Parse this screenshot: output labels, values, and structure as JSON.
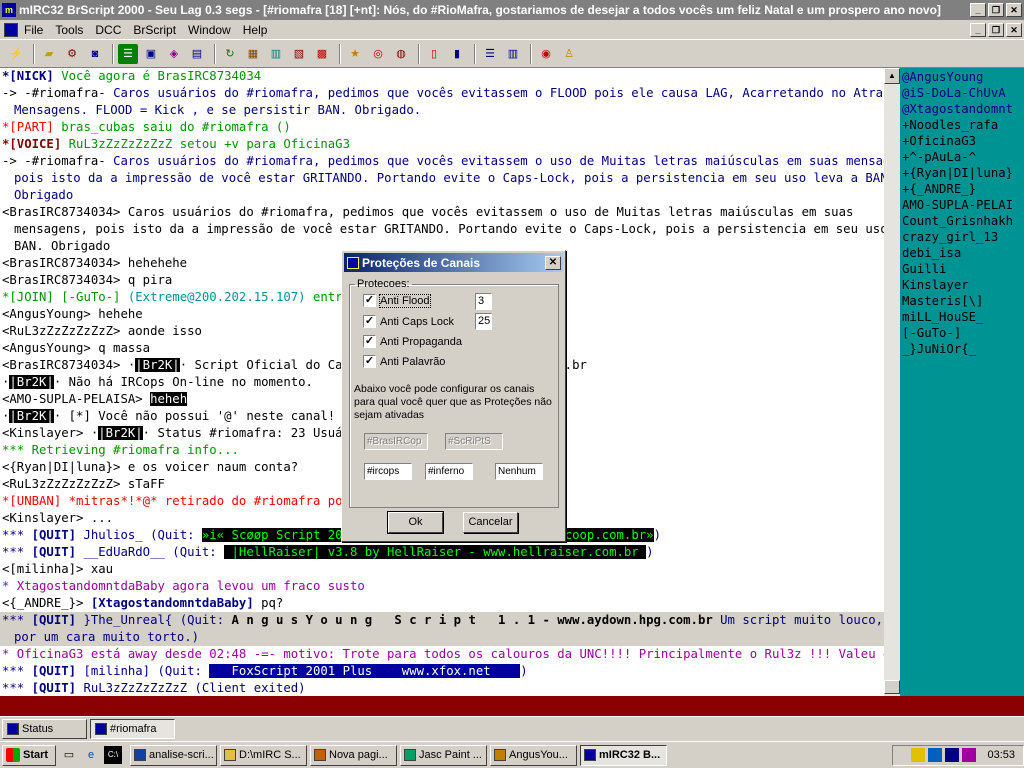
{
  "title": {
    "text": "mIRC32 BrScript 2000 - Seu Lag 0.3 segs - [#riomafra [18] [+nt]: Nós, do #RioMafra, gostariamos de desejar a todos vocês um feliz Natal e um prospero ano novo]",
    "buttons": [
      "_",
      "❐",
      "✕"
    ]
  },
  "menu": {
    "items": [
      "File",
      "Tools",
      "DCC",
      "BrScript",
      "Window",
      "Help"
    ],
    "right_buttons": [
      "_",
      "❐",
      "✕"
    ]
  },
  "toolbar": {
    "icons": [
      "connect-icon",
      "folder-icon",
      "settings-icon",
      "address-book-icon",
      "list-icon",
      "notify-icon",
      "dcc-send-icon",
      "dcc-chat-icon",
      "send-icon",
      "options-icon",
      "script-editor-icon",
      "remote-icon",
      "colors-icon",
      "users-icon",
      "log-icon",
      "tile-icon",
      "cascade-icon",
      "help-icon",
      "about-icon"
    ]
  },
  "chat": {
    "lines": [
      {
        "cls": "",
        "parts": [
          {
            "t": "*[NICK] ",
            "c": "blu bold"
          },
          {
            "t": "Você agora é BrasIRC8734034",
            "c": "grn"
          }
        ]
      },
      {
        "cls": "",
        "parts": [
          {
            "t": "-> -#riomafra- ",
            "c": "nick"
          },
          {
            "t": "Caros usuários do #riomafra, pedimos que vocês evitassem o FLOOD pois ele causa LAG, Acarretando no Atraso de",
            "c": "blu"
          }
        ]
      },
      {
        "cls": "ind",
        "parts": [
          {
            "t": "Mensagens. FLOOD = Kick , e se persistir BAN. Obrigado.",
            "c": "blu"
          }
        ]
      },
      {
        "cls": "",
        "parts": [
          {
            "t": "*[PART] ",
            "c": "red"
          },
          {
            "t": "bras_cubas saiu do #riomafra ()",
            "c": "grn"
          }
        ]
      },
      {
        "cls": "",
        "parts": [
          {
            "t": "*[VOICE] ",
            "c": "brw bold"
          },
          {
            "t": "RuL3zZzZzZzZzZ setou +v para OficinaG3",
            "c": "grn"
          }
        ]
      },
      {
        "cls": "",
        "parts": [
          {
            "t": "-> -#riomafra- ",
            "c": "nick"
          },
          {
            "t": "Caros usuários do #riomafra, pedimos que vocês evitassem o uso de Muitas letras maiúsculas em suas mensagens,",
            "c": "blu"
          }
        ]
      },
      {
        "cls": "ind",
        "parts": [
          {
            "t": "pois isto da a impressão de você estar GRITANDO. Portando evite o Caps-Lock, pois a persistencia em seu uso leva a BAN.",
            "c": "blu"
          }
        ]
      },
      {
        "cls": "ind",
        "parts": [
          {
            "t": "Obrigado",
            "c": "blu"
          }
        ]
      },
      {
        "cls": "",
        "parts": [
          {
            "t": "<BrasIRC8734034> ",
            "c": "nick"
          },
          {
            "t": "Caros usuários do #riomafra, pedimos que vocês evitassem o uso de Muitas letras maiúsculas em suas",
            "c": "nick"
          }
        ]
      },
      {
        "cls": "ind",
        "parts": [
          {
            "t": "mensagens, pois isto da a impressão de você estar GRITANDO. Portando evite o Caps-Lock, pois a persistencia em seu uso leva a",
            "c": "nick"
          }
        ]
      },
      {
        "cls": "ind",
        "parts": [
          {
            "t": "BAN. Obrigado",
            "c": "nick"
          }
        ]
      },
      {
        "cls": "",
        "parts": [
          {
            "t": "<BrasIRC8734034> hehehehe",
            "c": "nick"
          }
        ]
      },
      {
        "cls": "",
        "parts": [
          {
            "t": "<BrasIRC8734034> q pira",
            "c": "nick"
          }
        ]
      },
      {
        "cls": "",
        "parts": [
          {
            "t": "*[JOIN] ",
            "c": "grn"
          },
          {
            "t": "[-GuTo-] ",
            "c": "grn"
          },
          {
            "t": "(Extreme@200.202.15.107) ",
            "c": "teal"
          },
          {
            "t": "entrou",
            "c": "grn"
          }
        ]
      },
      {
        "cls": "",
        "parts": [
          {
            "t": "<AngusYoung> hehehe",
            "c": "nick"
          }
        ]
      },
      {
        "cls": "",
        "parts": [
          {
            "t": "<RuL3zZzZzZzZzZ> aonde isso",
            "c": "nick"
          }
        ]
      },
      {
        "cls": "",
        "parts": [
          {
            "t": "<AngusYoung> q massa",
            "c": "nick"
          }
        ]
      },
      {
        "cls": "",
        "parts": [
          {
            "t": "<BrasIRC8734034> ·",
            "c": "nick"
          },
          {
            "t": "|Br2K|",
            "c": "hl"
          },
          {
            "t": "· Script Oficial do Canal",
            "c": "nick"
          },
          {
            "t": "                          m.br",
            "c": "nick"
          }
        ]
      },
      {
        "cls": "",
        "parts": [
          {
            "t": "·",
            "c": "nick"
          },
          {
            "t": "|Br2K|",
            "c": "hl"
          },
          {
            "t": "· Não há IRCops On-line no momento.",
            "c": "nick"
          }
        ]
      },
      {
        "cls": "",
        "parts": [
          {
            "t": "<AMO-SUPLA-PELAISA> ",
            "c": "nick"
          },
          {
            "t": "heheh",
            "c": "hl"
          }
        ]
      },
      {
        "cls": "",
        "parts": [
          {
            "t": "·",
            "c": "nick"
          },
          {
            "t": "|Br2K|",
            "c": "hl"
          },
          {
            "t": "· [*] Você não possui '@' neste canal!",
            "c": "nick"
          }
        ]
      },
      {
        "cls": "",
        "parts": [
          {
            "t": "<Kinslayer> ·",
            "c": "nick"
          },
          {
            "t": "|Br2K|",
            "c": "hl"
          },
          {
            "t": "· Status #riomafra: 23 Usuário",
            "c": "nick"
          }
        ]
      },
      {
        "cls": "",
        "parts": [
          {
            "t": "*** Retrieving #riomafra info...",
            "c": "grn"
          }
        ]
      },
      {
        "cls": "",
        "parts": [
          {
            "t": "<{Ryan|DI|luna}> e os voicer naum conta?",
            "c": "nick"
          }
        ]
      },
      {
        "cls": "",
        "parts": [
          {
            "t": "<RuL3zZzZzZzZzZ> sTaFF",
            "c": "nick"
          }
        ]
      },
      {
        "cls": "",
        "parts": [
          {
            "t": "*[UNBAN] ",
            "c": "red"
          },
          {
            "t": "*mitras*!*@* retirado do #riomafra por",
            "c": "red"
          }
        ]
      },
      {
        "cls": "",
        "parts": [
          {
            "t": "<Kinslayer> ...",
            "c": "nick"
          }
        ]
      },
      {
        "cls": "",
        "parts": [
          {
            "t": "*** ",
            "c": "blu"
          },
          {
            "t": "[QUIT] ",
            "c": "blu bold"
          },
          {
            "t": "Jhulios_ (Quit: ",
            "c": "blu"
          },
          {
            "t": "»i« Scøøp Script 2001",
            "c": "bk"
          },
          {
            "t": "                         ",
            "c": ""
          },
          {
            "t": "v.scoop.com.br»",
            "c": "bk"
          },
          {
            "t": ")",
            "c": "blu"
          }
        ]
      },
      {
        "cls": "",
        "parts": [
          {
            "t": "*** ",
            "c": "blu"
          },
          {
            "t": "[QUIT] ",
            "c": "blu bold"
          },
          {
            "t": "__EdUaRdO__ (Quit: ",
            "c": "blu"
          },
          {
            "t": " |HellRaiser| v3.8 by HellRaiser - www.hellraiser.com.br ",
            "c": "bk"
          },
          {
            "t": ")",
            "c": "blu"
          }
        ]
      },
      {
        "cls": "",
        "parts": [
          {
            "t": "<[milinha]> xau",
            "c": "nick"
          }
        ]
      },
      {
        "cls": "",
        "parts": [
          {
            "t": "* XtagostandomntdaBaby agora levou um fraco susto",
            "c": "pur"
          }
        ]
      },
      {
        "cls": "",
        "parts": [
          {
            "t": "<{_ANDRE_}> ",
            "c": "nick"
          },
          {
            "t": "[XtagostandomntdaBaby] ",
            "c": "blu bold"
          },
          {
            "t": "pq?",
            "c": "nick"
          }
        ]
      },
      {
        "cls": "hilite",
        "parts": [
          {
            "t": "*** ",
            "c": "blu"
          },
          {
            "t": "[QUIT] ",
            "c": "blu bold"
          },
          {
            "t": "}The_Unreal{ (Quit: ",
            "c": "blu"
          },
          {
            "t": "A n g u s Y o u n g   S c r i p t   1 . 1 - www.aydown.hpg.com.br",
            "c": "nick bold"
          },
          {
            "t": " Um script muito louco, feito",
            "c": "blu"
          }
        ]
      },
      {
        "cls": "hilite ind",
        "parts": [
          {
            "t": "por um cara muito torto.)",
            "c": "blu"
          }
        ]
      },
      {
        "cls": "",
        "parts": [
          {
            "t": "* OficinaG3 está away desde 02:48 -=- motivo: Trote para todos os calouros da UNC!!!! Principalmente o Rul3z !!! Valeu galera!!!!!",
            "c": "pur"
          }
        ]
      },
      {
        "cls": "",
        "parts": [
          {
            "t": "*** ",
            "c": "blu"
          },
          {
            "t": "[QUIT] ",
            "c": "blu bold"
          },
          {
            "t": "[milinha] (Quit: ",
            "c": "blu"
          },
          {
            "t": "   FoxScript 2001 Plus    www.xfox.net    ",
            "c": "blubk"
          },
          {
            "t": ")",
            "c": "blu"
          }
        ]
      },
      {
        "cls": "",
        "parts": [
          {
            "t": "*** ",
            "c": "blu"
          },
          {
            "t": "[QUIT] ",
            "c": "blu bold"
          },
          {
            "t": "RuL3zZzZzZzZzZ (Client exited)",
            "c": "blu"
          }
        ]
      }
    ]
  },
  "nicklist": [
    "@AngusYoung",
    "@iS-DoLa-ChUvA",
    "@Xtagostandomnt",
    "+Noodles_rafa",
    "+OficinaG3",
    "+^-pAuLa-^",
    "+{Ryan|DI|luna}",
    "+{_ANDRE_}",
    "AMO-SUPLA-PELAI",
    "Count_Grisnhakh",
    "crazy_girl_13",
    "debi_isa",
    "Guilli",
    "Kinslayer",
    "Masteris[\\]",
    "miLL_HouSE_",
    "[-GuTo-]",
    "_}JuNiOr{_"
  ],
  "dialog": {
    "title": "Proteções de Canais",
    "close": "✕",
    "group": "Protecoes:",
    "options": [
      {
        "label": "Anti Flood",
        "checked": "✓",
        "value": "3"
      },
      {
        "label": "Anti Caps Lock",
        "checked": "✓",
        "value": "25"
      },
      {
        "label": "Anti Propaganda",
        "checked": "✓"
      },
      {
        "label": "Anti Palavrão",
        "checked": "✓"
      }
    ],
    "note": "Abaixo você pode configurar os canais para qual você quer que as Proteções não sejam ativadas",
    "disabled_fields": [
      "#BrasIRCop",
      "#ScRiPtS"
    ],
    "fields": [
      "#ircops",
      "#inferno",
      "Nenhum"
    ],
    "ok": "Ok",
    "cancel": "Cancelar"
  },
  "switchbar": {
    "items": [
      "Status",
      "#riomafra"
    ]
  },
  "taskbar": {
    "start": "Start",
    "tasks": [
      "analise-scri...",
      "D:\\mIRC S...",
      "Nova pagi...",
      "Jasc Paint ...",
      "AngusYou...",
      "mIRC32 B..."
    ],
    "clock": "03:53"
  }
}
